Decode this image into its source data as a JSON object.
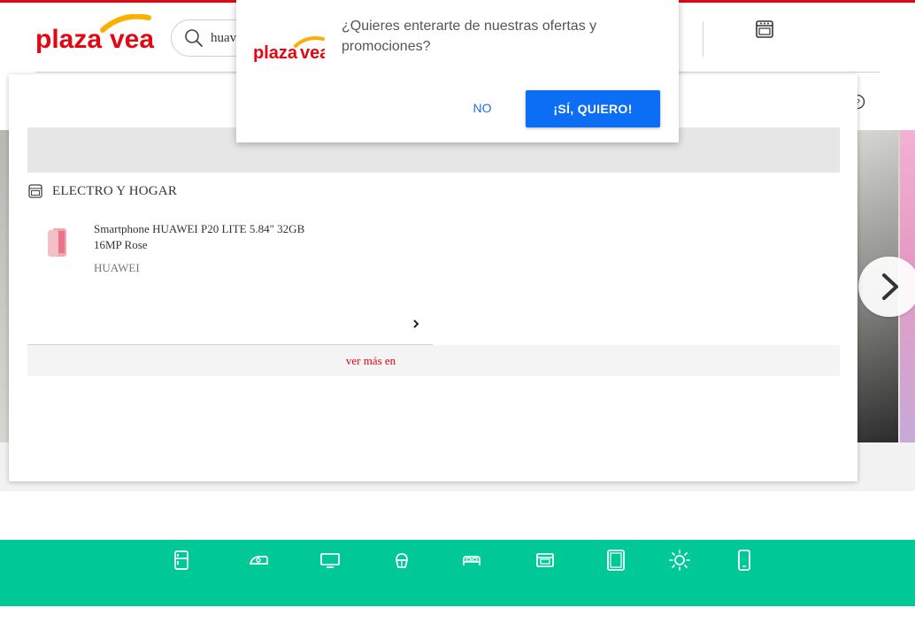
{
  "brand": {
    "name": "plazavea",
    "accent": "#e30613",
    "logo_red": "#e30613",
    "logo_yellow": "#f9b000"
  },
  "search": {
    "value": "huawei",
    "visible_text": "huav"
  },
  "header": {
    "top_icon": "oven-icon",
    "help_icon": "question-circle-icon"
  },
  "popup": {
    "message": "¿Quieres enterarte de nuestras ofertas y promociones?",
    "no_label": "NO",
    "yes_label": "¡SÍ, QUIERO!",
    "yes_color": "#0b6ef5"
  },
  "dropdown": {
    "category": {
      "icon": "oven-icon",
      "label": "ELECTRO Y HOGAR"
    },
    "product": {
      "name": "Smartphone HUAWEI P20 LITE 5.84\" 32GB 16MP Rose",
      "brand": "HUAWEI"
    },
    "see_more": "ver más en"
  },
  "footer_categories": [
    {
      "icon": "refrigerator-icon"
    },
    {
      "icon": "iron-icon"
    },
    {
      "icon": "tv-icon"
    },
    {
      "icon": "cupcake-icon"
    },
    {
      "icon": "bed-icon"
    },
    {
      "icon": "oven-icon"
    },
    {
      "icon": "tablet-icon"
    },
    {
      "icon": "sun-icon"
    },
    {
      "icon": "smartphone-icon"
    }
  ],
  "colors": {
    "footer_bar": "#00c896"
  }
}
